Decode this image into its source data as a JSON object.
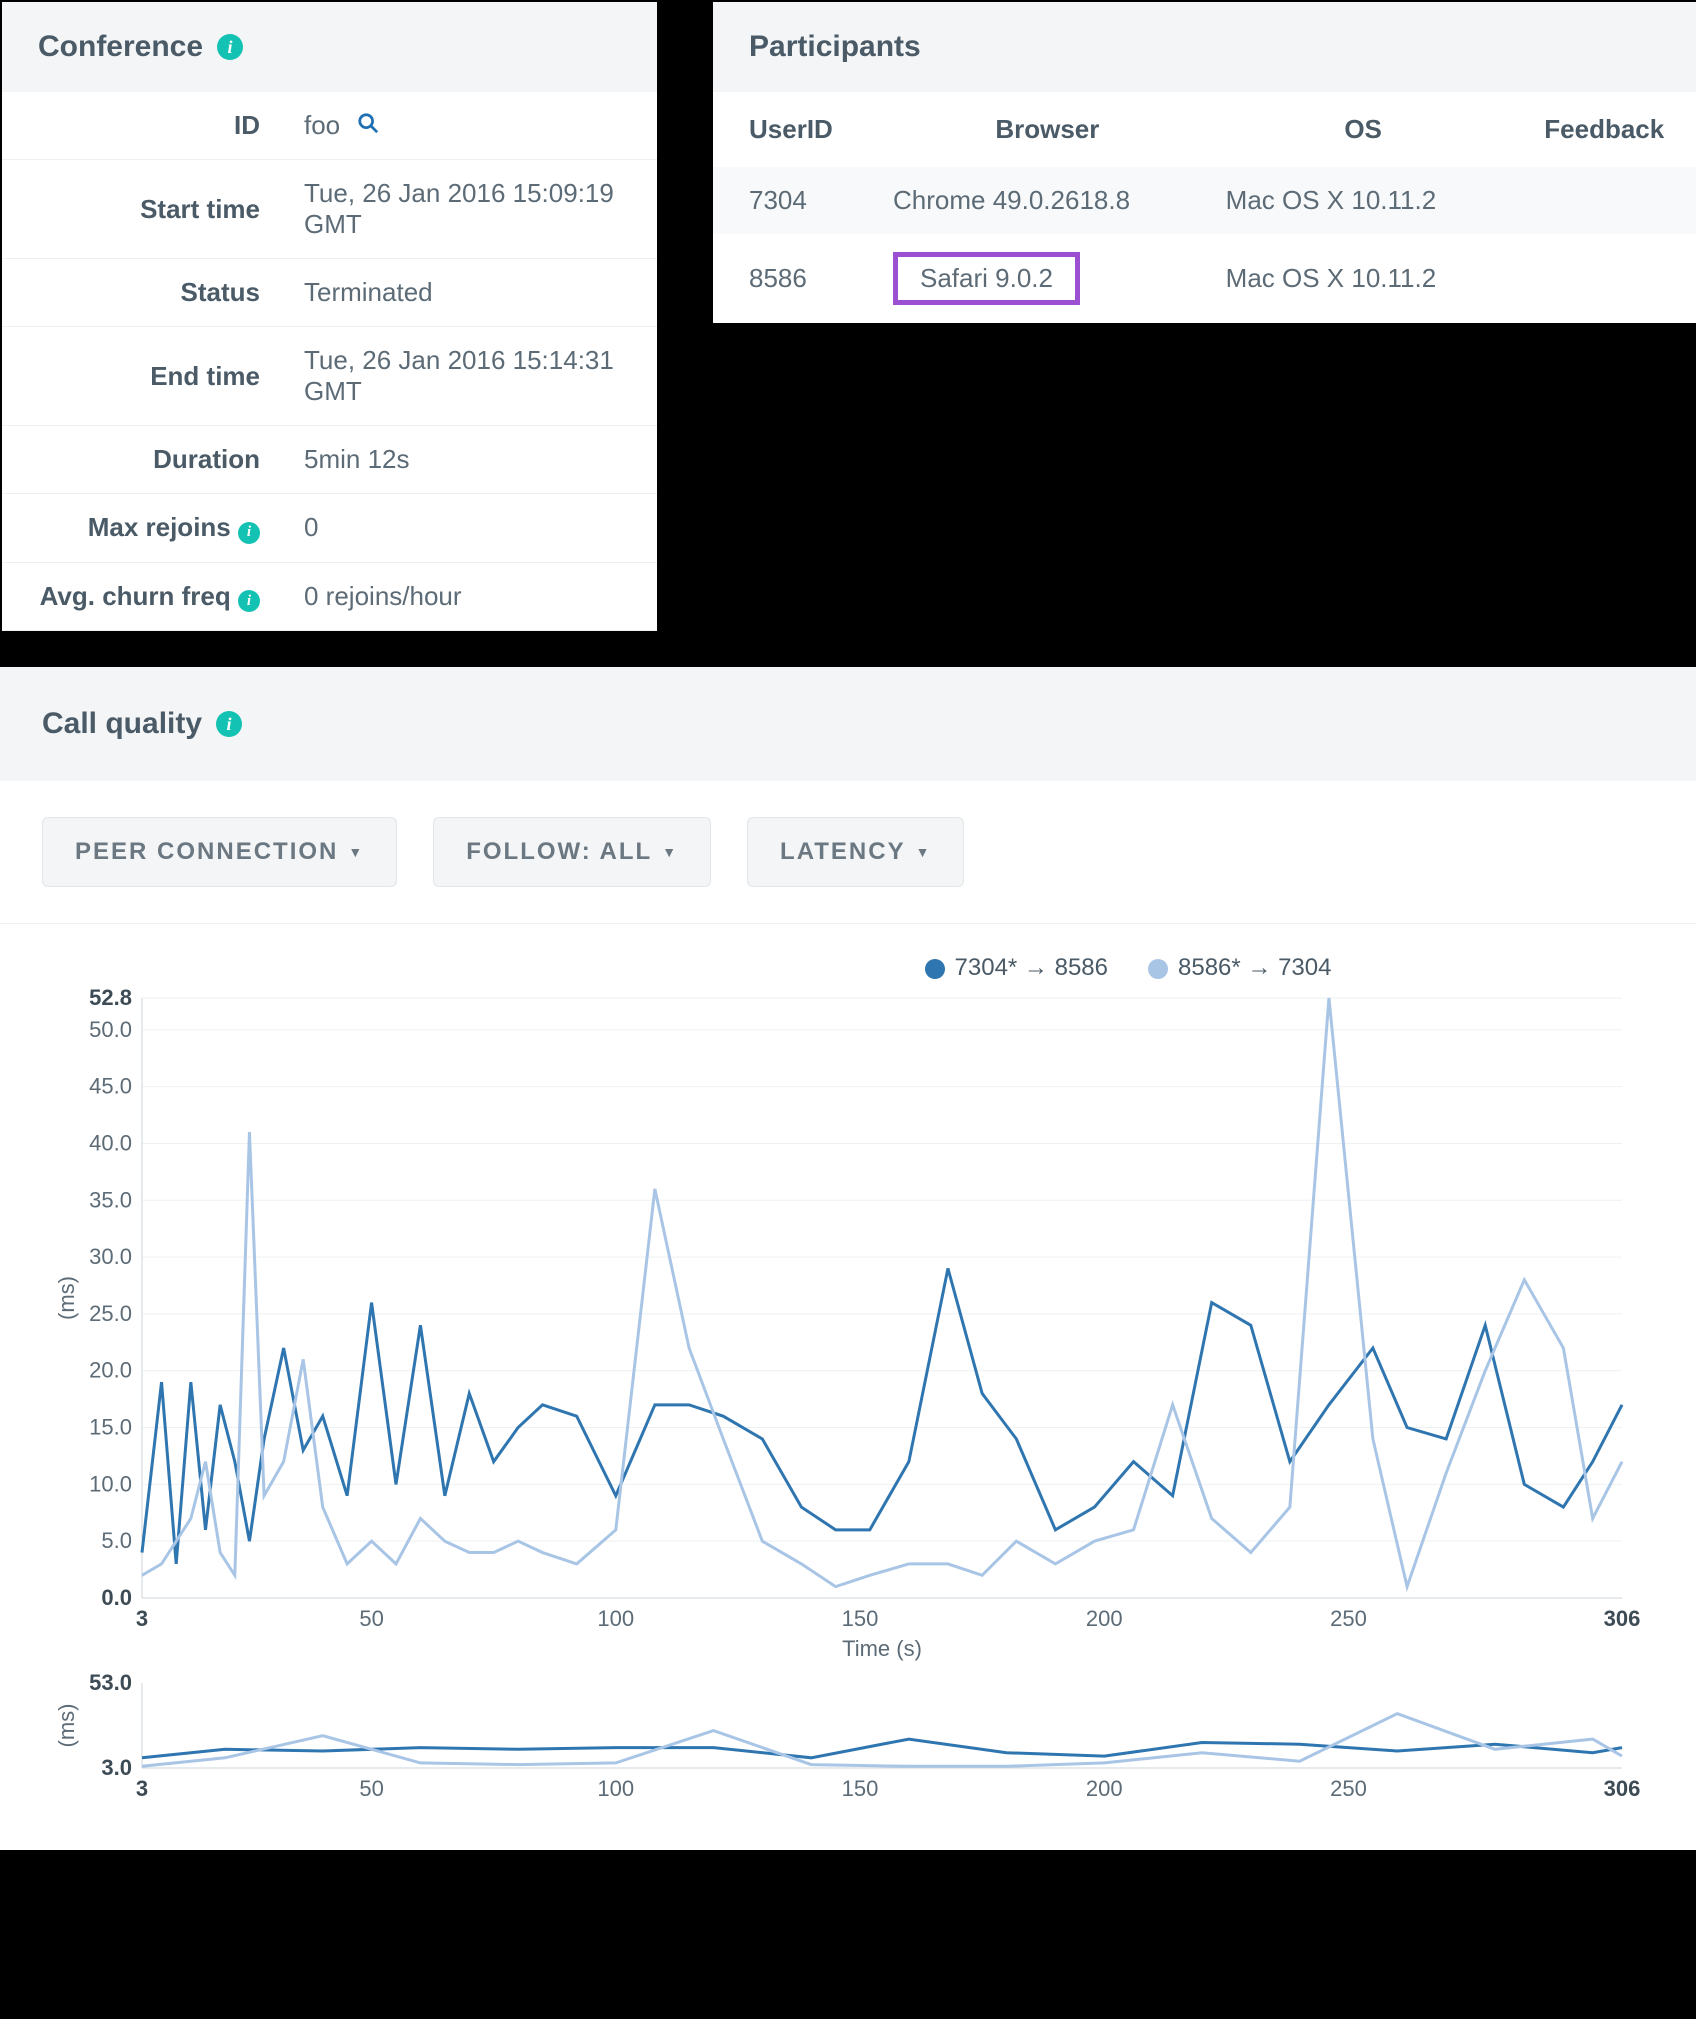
{
  "conference": {
    "title": "Conference",
    "rows": {
      "id_label": "ID",
      "id_value": "foo",
      "start_label": "Start time",
      "start_value": "Tue, 26 Jan 2016 15:09:19 GMT",
      "status_label": "Status",
      "status_value": "Terminated",
      "end_label": "End time",
      "end_value": "Tue, 26 Jan 2016 15:14:31 GMT",
      "duration_label": "Duration",
      "duration_value": "5min 12s",
      "rejoins_label": "Max rejoins",
      "rejoins_value": "0",
      "churn_label": "Avg. churn freq",
      "churn_value": "0 rejoins/hour"
    }
  },
  "participants": {
    "title": "Participants",
    "headers": {
      "user": "UserID",
      "browser": "Browser",
      "os": "OS",
      "feedback": "Feedback"
    },
    "rows": [
      {
        "user": "7304",
        "browser": "Chrome 49.0.2618.8",
        "os": "Mac OS X 10.11.2",
        "feedback": "",
        "highlight": false
      },
      {
        "user": "8586",
        "browser": "Safari 9.0.2",
        "os": "Mac OS X 10.11.2",
        "feedback": "",
        "highlight": true
      }
    ]
  },
  "quality": {
    "title": "Call quality",
    "filters": {
      "peer": "PEER CONNECTION",
      "follow": "FOLLOW: ALL",
      "metric": "LATENCY"
    },
    "legend": {
      "s1": "7304* → 8586",
      "s2": "8586* → 7304"
    }
  },
  "chart_data": [
    {
      "type": "line",
      "title": "",
      "xlabel": "Time (s)",
      "ylabel": "(ms)",
      "xlim": [
        3,
        306
      ],
      "ylim": [
        0,
        52.8
      ],
      "yticks": [
        0,
        5,
        10,
        15,
        20,
        25,
        30,
        35,
        40,
        45,
        50,
        52.8
      ],
      "xticks": [
        3,
        50,
        100,
        150,
        200,
        250,
        306
      ],
      "series": [
        {
          "name": "7304* → 8586",
          "color": "#2f76b0",
          "x": [
            3,
            7,
            10,
            13,
            16,
            19,
            22,
            25,
            28,
            32,
            36,
            40,
            45,
            50,
            55,
            60,
            65,
            70,
            75,
            80,
            85,
            92,
            100,
            108,
            115,
            122,
            130,
            138,
            145,
            152,
            160,
            168,
            175,
            182,
            190,
            198,
            206,
            214,
            222,
            230,
            238,
            246,
            255,
            262,
            270,
            278,
            286,
            294,
            300,
            306
          ],
          "y": [
            4,
            19,
            3,
            19,
            6,
            17,
            12,
            5,
            14,
            22,
            13,
            16,
            9,
            26,
            10,
            24,
            9,
            18,
            12,
            15,
            17,
            16,
            9,
            17,
            17,
            16,
            14,
            8,
            6,
            6,
            12,
            29,
            18,
            14,
            6,
            8,
            12,
            9,
            26,
            24,
            12,
            17,
            22,
            15,
            14,
            24,
            10,
            8,
            12,
            17
          ]
        },
        {
          "name": "8586* → 7304",
          "color": "#a9c5e6",
          "x": [
            3,
            7,
            10,
            13,
            16,
            19,
            22,
            25,
            28,
            32,
            36,
            40,
            45,
            50,
            55,
            60,
            65,
            70,
            75,
            80,
            85,
            92,
            100,
            108,
            115,
            122,
            130,
            138,
            145,
            152,
            160,
            168,
            175,
            182,
            190,
            198,
            206,
            214,
            222,
            230,
            238,
            246,
            255,
            262,
            270,
            278,
            286,
            294,
            300,
            306
          ],
          "y": [
            2,
            3,
            5,
            7,
            12,
            4,
            2,
            41,
            9,
            12,
            21,
            8,
            3,
            5,
            3,
            7,
            5,
            4,
            4,
            5,
            4,
            3,
            6,
            36,
            22,
            14,
            5,
            3,
            1,
            2,
            3,
            3,
            2,
            5,
            3,
            5,
            6,
            17,
            7,
            4,
            8,
            52.8,
            14,
            1,
            11,
            20,
            28,
            22,
            7,
            12
          ]
        }
      ]
    },
    {
      "type": "line",
      "title": "",
      "xlabel": "",
      "ylabel": "(ms)",
      "xlim": [
        3,
        306
      ],
      "ylim": [
        3,
        53
      ],
      "yticks": [
        3,
        53
      ],
      "xticks": [
        3,
        50,
        100,
        150,
        200,
        250,
        306
      ],
      "series": [
        {
          "name": "7304* → 8586",
          "color": "#2f76b0",
          "x": [
            3,
            20,
            40,
            60,
            80,
            100,
            120,
            140,
            160,
            180,
            200,
            220,
            240,
            260,
            280,
            300,
            306
          ],
          "y": [
            9,
            14,
            13,
            15,
            14,
            15,
            15,
            9,
            20,
            12,
            10,
            18,
            17,
            13,
            17,
            12,
            15
          ]
        },
        {
          "name": "8586* → 7304",
          "color": "#a9c5e6",
          "x": [
            3,
            20,
            40,
            60,
            80,
            100,
            120,
            140,
            160,
            180,
            200,
            220,
            240,
            260,
            280,
            300,
            306
          ],
          "y": [
            4,
            9,
            22,
            6,
            5,
            6,
            25,
            5,
            4,
            4,
            6,
            12,
            7,
            35,
            14,
            20,
            10
          ]
        }
      ]
    }
  ]
}
